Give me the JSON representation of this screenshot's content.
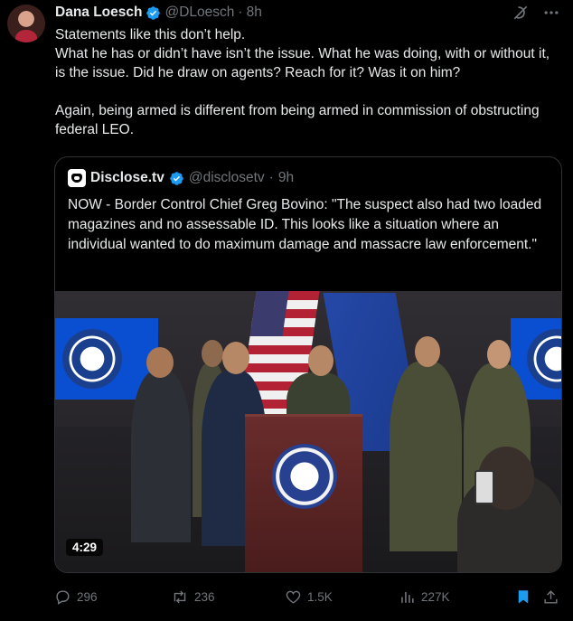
{
  "author": {
    "name": "Dana Loesch",
    "handle": "@DLoesch",
    "separator": "·",
    "time": "8h"
  },
  "tweet_text": "Statements like this don’t help.\nWhat he has or didn’t have isn’t the issue. What he was doing, with or without it, is the issue. Did he draw on agents? Reach for it? Was it on him?\n\nAgain, being armed is different from being armed in commission of obstructing federal LEO.",
  "quoted": {
    "name": "Disclose.tv",
    "handle": "@disclosetv",
    "separator": "·",
    "time": "9h",
    "text": "NOW - Border Control Chief Greg Bovino: \"The suspect also had two loaded magazines and no assessable ID. This looks like a situation where an individual wanted to do maximum damage and massacre law enforcement.\"",
    "video_duration": "4:29"
  },
  "metrics": {
    "replies": "296",
    "reposts": "236",
    "likes": "1.5K",
    "views": "227K"
  },
  "colors": {
    "background": "#000000",
    "text": "#e7e9ea",
    "secondary": "#71767b",
    "verified": "#1d9bf0",
    "bookmark": "#1d9bf0",
    "border": "#2f3336"
  },
  "icons": [
    "verified-badge-icon",
    "grok-icon",
    "more-icon",
    "reply-icon",
    "repost-icon",
    "like-icon",
    "views-icon",
    "bookmark-icon",
    "share-icon"
  ]
}
